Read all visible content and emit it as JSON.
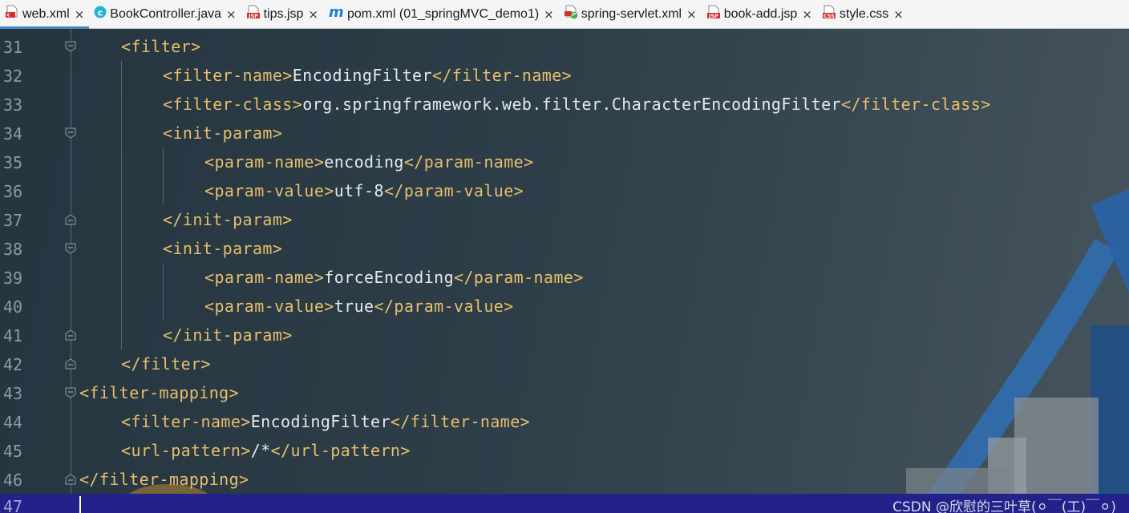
{
  "tabs": [
    {
      "label": "web.xml",
      "icon": "xml-file-icon",
      "active": true
    },
    {
      "label": "BookController.java",
      "icon": "java-class-icon",
      "active": false
    },
    {
      "label": "tips.jsp",
      "icon": "jsp-file-icon",
      "active": false
    },
    {
      "label": "pom.xml (01_springMVC_demo1)",
      "icon": "maven-icon",
      "active": false
    },
    {
      "label": "spring-servlet.xml",
      "icon": "spring-xml-icon",
      "active": false
    },
    {
      "label": "book-add.jsp",
      "icon": "jsp-file-icon",
      "active": false
    },
    {
      "label": "style.css",
      "icon": "css-file-icon",
      "active": false
    }
  ],
  "close_glyph": "×",
  "maven_glyph": "m",
  "icon_labels": {
    "jsp": "JSP",
    "css": "CSS"
  },
  "code_lines": [
    {
      "n": "31",
      "parts": [
        [
          "tag",
          "<filter>"
        ]
      ]
    },
    {
      "n": "32",
      "parts": [
        [
          "tag",
          "<filter-name>"
        ],
        [
          "txt",
          "EncodingFilter"
        ],
        [
          "tag",
          "</filter-name>"
        ]
      ]
    },
    {
      "n": "33",
      "parts": [
        [
          "tag",
          "<filter-class>"
        ],
        [
          "txt",
          "org.springframework.web.filter.CharacterEncodingFilter"
        ],
        [
          "tag",
          "</filter-class>"
        ]
      ]
    },
    {
      "n": "34",
      "parts": [
        [
          "tag",
          "<init-param>"
        ]
      ]
    },
    {
      "n": "35",
      "parts": [
        [
          "tag",
          "<param-name>"
        ],
        [
          "txt",
          "encoding"
        ],
        [
          "tag",
          "</param-name>"
        ]
      ]
    },
    {
      "n": "36",
      "parts": [
        [
          "tag",
          "<param-value>"
        ],
        [
          "txt",
          "utf-8"
        ],
        [
          "tag",
          "</param-value>"
        ]
      ]
    },
    {
      "n": "37",
      "parts": [
        [
          "tag",
          "</init-param>"
        ]
      ]
    },
    {
      "n": "38",
      "parts": [
        [
          "tag",
          "<init-param>"
        ]
      ]
    },
    {
      "n": "39",
      "parts": [
        [
          "tag",
          "<param-name>"
        ],
        [
          "txt",
          "forceEncoding"
        ],
        [
          "tag",
          "</param-name>"
        ]
      ]
    },
    {
      "n": "40",
      "parts": [
        [
          "tag",
          "<param-value>"
        ],
        [
          "txt",
          "true"
        ],
        [
          "tag",
          "</param-value>"
        ]
      ]
    },
    {
      "n": "41",
      "parts": [
        [
          "tag",
          "</init-param>"
        ]
      ]
    },
    {
      "n": "42",
      "parts": [
        [
          "tag",
          "</filter>"
        ]
      ]
    },
    {
      "n": "43",
      "parts": [
        [
          "tag",
          "<filter-mapping>"
        ]
      ]
    },
    {
      "n": "44",
      "parts": [
        [
          "tag",
          "<filter-name>"
        ],
        [
          "txt",
          "EncodingFilter"
        ],
        [
          "tag",
          "</filter-name>"
        ]
      ]
    },
    {
      "n": "45",
      "parts": [
        [
          "tag",
          "<url-pattern>"
        ],
        [
          "txt",
          "/*"
        ],
        [
          "tag",
          "</url-pattern>"
        ]
      ]
    },
    {
      "n": "46",
      "parts": [
        [
          "tag",
          "</filter-mapping>"
        ]
      ]
    }
  ],
  "current_line": "47",
  "watermark": "CSDN @欣慰的三叶草(⚪￣(工)￣⚪)",
  "colors": {
    "tag": "#e8bf6a",
    "text": "#e6e9eb",
    "line_number": "#8e9aa1",
    "active_tab_underline": "#4a86c7",
    "current_line_bg": "#22228a"
  }
}
